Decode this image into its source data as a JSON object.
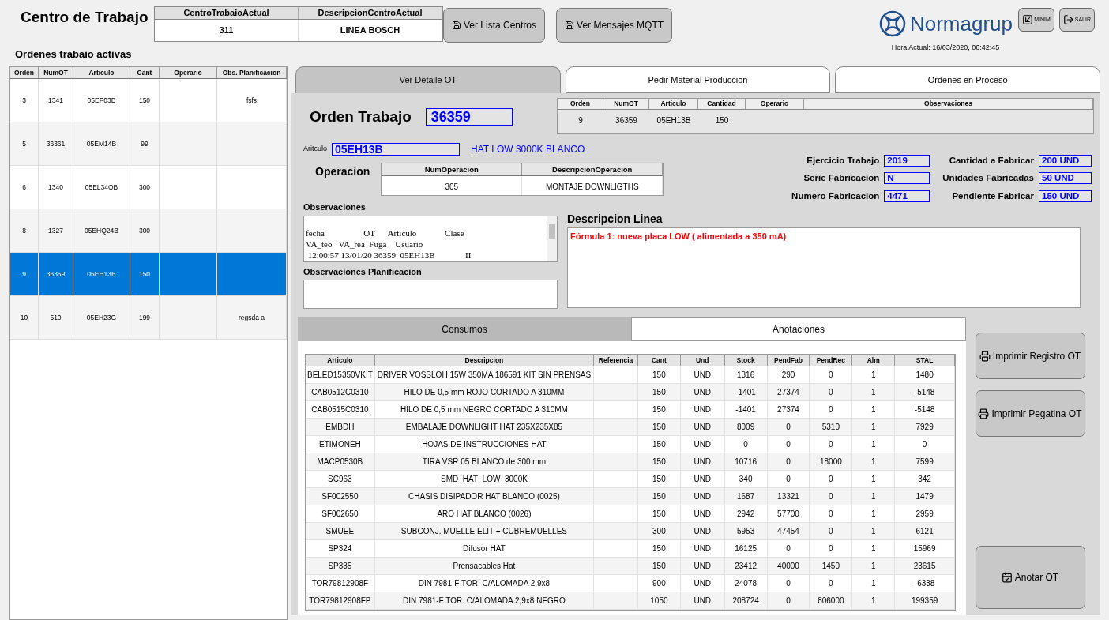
{
  "header": {
    "title": "Centro de Trabajo",
    "center_table": {
      "columns": [
        "CentroTrabaioActual",
        "DescripcionCentroActual"
      ],
      "row": [
        "311",
        "LINEA BOSCH"
      ]
    },
    "buttons": [
      {
        "label": "Ver Lista Centros"
      },
      {
        "label": "Ver Mensajes MQTT"
      }
    ],
    "logo": "Normagrup",
    "window_buttons": [
      {
        "kind": "minimize",
        "label": "MINIM"
      },
      {
        "kind": "exit",
        "label": "SALIR"
      }
    ],
    "clock": "Hora Actual: 16/03/2020, 06:42:45"
  },
  "orders": {
    "title": "Ordenes trabaio activas",
    "columns": [
      "Orden",
      "NumOT",
      "Articulo",
      "Cant",
      "Operario",
      "Obs. Planificacion"
    ],
    "rows": [
      {
        "cells": [
          "3",
          "1341",
          "05EP03B",
          "150",
          "",
          "fsfs"
        ],
        "selected": false
      },
      {
        "cells": [
          "5",
          "36361",
          "05EM14B",
          "99",
          "",
          ""
        ],
        "selected": false
      },
      {
        "cells": [
          "6",
          "1340",
          "05EL34OB",
          "300",
          "",
          ""
        ],
        "selected": false
      },
      {
        "cells": [
          "8",
          "1327",
          "05EHQ24B",
          "300",
          "",
          ""
        ],
        "selected": false
      },
      {
        "cells": [
          "9",
          "36359",
          "05EH13B",
          "150",
          "",
          ""
        ],
        "selected": true
      },
      {
        "cells": [
          "10",
          "510",
          "05EH23G",
          "199",
          "",
          "regsda a"
        ],
        "selected": false
      }
    ]
  },
  "tabs": [
    {
      "label": "Ver Detalle OT",
      "selected": true
    },
    {
      "label": "Pedir Material Produccion",
      "selected": false
    },
    {
      "label": "Ordenes en  Proceso",
      "selected": false
    }
  ],
  "detail": {
    "orden_label": "Orden Trabajo",
    "orden_value": "36359",
    "summary_table": {
      "columns": [
        "Orden",
        "NumOT",
        "Articulo",
        "Cantidad",
        "Operario",
        "Observaciones"
      ],
      "rows": [
        [
          "9",
          "36359",
          "05EH13B",
          "150",
          "",
          ""
        ]
      ]
    },
    "articulo_label": "Aritculo",
    "articulo_value": "05EH13B",
    "articulo_desc": "HAT LOW 3000K  BLANCO",
    "operacion_label": "Operacion",
    "operacion_table": {
      "columns": [
        "NumOperacion",
        "DescripcionOperacion"
      ],
      "rows": [
        [
          "305",
          "MONTAJE DOWNLIGTHS"
        ]
      ]
    },
    "fields": [
      {
        "label": "Ejercicio Trabajo",
        "value": "2019"
      },
      {
        "label": "Cantidad a Fabricar",
        "value": "200 UND"
      },
      {
        "label": "Serie Fabricacion",
        "value": "N"
      },
      {
        "label": "Unidades Fabricadas",
        "value": "50 UND"
      },
      {
        "label": "Numero Fabricacion",
        "value": "4471"
      },
      {
        "label": "Pendiente Fabricar",
        "value": "150 UND"
      }
    ],
    "observaciones": {
      "label": "Observaciones",
      "lines": [
        "fecha                  OT      Articulo             Clase",
        "VA_teo   VA_rea  Fuga    Usuario",
        " 12:00:57 13/01/20 36359  05EH13B              II"
      ]
    },
    "obs_planificacion": {
      "label": "Observaciones Planificacion"
    },
    "descripcion_linea": {
      "label": "Descripcion Linea",
      "text": "Fórmula 1: nueva placa LOW ( alimentada a 350 mA)"
    }
  },
  "sub_tabs": [
    {
      "label": "Consumos",
      "selected": true
    },
    {
      "label": "Anotaciones",
      "selected": false
    }
  ],
  "consumos": {
    "columns": [
      "Articulo",
      "Descripcion",
      "Referencia",
      "Cant",
      "Und",
      "Stock",
      "PendFab",
      "PendRec",
      "Alm",
      "STAL"
    ],
    "rows": [
      [
        "BELED15350VKIT",
        "DRIVER VOSSLOH 15W 350MA 186591 KIT SIN PRENSAS",
        "",
        "150",
        "UND",
        "1316",
        "290",
        "0",
        "1",
        "1480"
      ],
      [
        "CAB0512C0310",
        "HILO  DE 0,5 mm ROJO CORTADO A 310MM",
        "",
        "150",
        "UND",
        "-1401",
        "27374",
        "0",
        "1",
        "-5148"
      ],
      [
        "CAB0515C0310",
        "HILO  DE 0,5 mm NEGRO CORTADO A 310MM",
        "",
        "150",
        "UND",
        "-1401",
        "27374",
        "0",
        "1",
        "-5148"
      ],
      [
        "EMBDH",
        "EMBALAJE DOWNLIGHT HAT 235X235X85",
        "",
        "150",
        "UND",
        "8009",
        "0",
        "5310",
        "1",
        "7929"
      ],
      [
        "ETIMONEH",
        "HOJAS DE INSTRUCCIONES HAT",
        "",
        "150",
        "UND",
        "0",
        "0",
        "0",
        "1",
        "0"
      ],
      [
        "MACP0530B",
        "TIRA VSR 05 BLANCO de 300 mm",
        "",
        "150",
        "UND",
        "10716",
        "0",
        "18000",
        "1",
        "7599"
      ],
      [
        "SC963",
        "SMD_HAT_LOW_3000K",
        "",
        "150",
        "UND",
        "340",
        "0",
        "0",
        "1",
        "342"
      ],
      [
        "SF002550",
        "CHASIS DISIPADOR HAT BLANCO (0025)",
        "",
        "150",
        "UND",
        "1687",
        "13321",
        "0",
        "1",
        "1479"
      ],
      [
        "SF002650",
        "ARO HAT BLANCO (0026)",
        "",
        "150",
        "UND",
        "2942",
        "57700",
        "0",
        "1",
        "2959"
      ],
      [
        "SMUEE",
        "SUBCONJ. MUELLE ELIT + CUBREMUELLES",
        "",
        "300",
        "UND",
        "5953",
        "47454",
        "0",
        "1",
        "6121"
      ],
      [
        "SP324",
        "Difusor HAT",
        "",
        "150",
        "UND",
        "16125",
        "0",
        "0",
        "1",
        "15969"
      ],
      [
        "SP335",
        "Prensacables Hat",
        "",
        "150",
        "UND",
        "23412",
        "40000",
        "1450",
        "1",
        "23615"
      ],
      [
        "TOR79812908F",
        "DIN 7981-F  TOR. C/ALOMADA  2,9x8",
        "",
        "900",
        "UND",
        "24078",
        "0",
        "0",
        "1",
        "-6338"
      ],
      [
        "TOR79812908FP",
        "DIN 7981-F  TOR. C/ALOMADA  2,9x8 NEGRO",
        "",
        "1050",
        "UND",
        "208724",
        "0",
        "806000",
        "1",
        "199359"
      ]
    ]
  },
  "actions": [
    {
      "kind": "print",
      "label": "Imprimir Registro OT"
    },
    {
      "kind": "print",
      "label": "Imprimir Pegatina OT"
    },
    {
      "kind": "annotate",
      "label": "Anotar OT"
    }
  ]
}
